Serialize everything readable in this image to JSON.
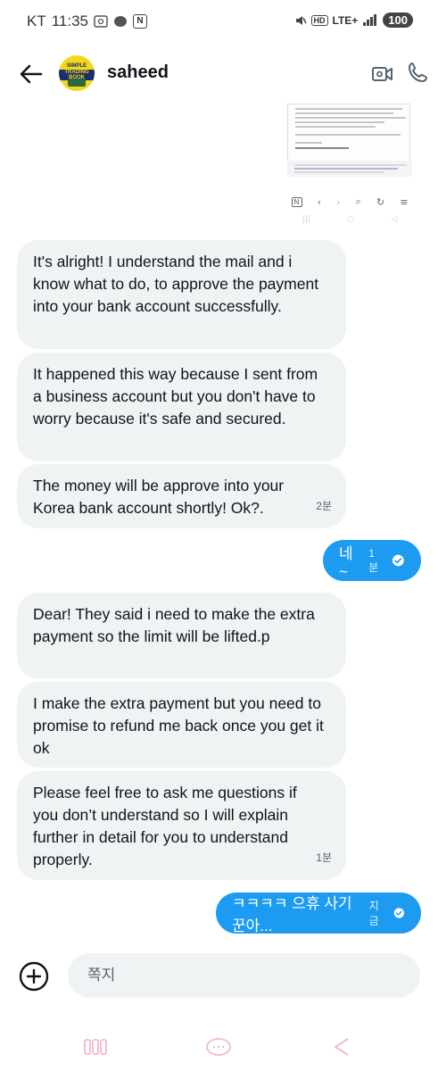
{
  "status_bar": {
    "carrier": "KT",
    "time": "11:35",
    "hd_label": "HD",
    "network": "LTE+",
    "battery": "100"
  },
  "header": {
    "username": "saheed",
    "avatar_text_line1": "SIMPLE",
    "avatar_text_line2": "TRADING BOOK"
  },
  "attachment": {
    "nav_n_label": "N"
  },
  "messages": [
    {
      "direction": "in",
      "text": "It's alright! I understand the mail and i know what to do, to approve the payment into your bank account successfully.",
      "time": ""
    },
    {
      "direction": "in",
      "text": "It happened this way because I sent from a business account but you don't have to worry because it's safe and secured.",
      "time": ""
    },
    {
      "direction": "in",
      "text": "The money will be approve into your Korea bank account shortly! Ok?.",
      "time": "2분"
    },
    {
      "direction": "out",
      "text": "네~",
      "time": "1분"
    },
    {
      "direction": "in",
      "text": "Dear! They said i need to make the extra payment so the limit will be lifted.p",
      "time": ""
    },
    {
      "direction": "in",
      "text": "I  make the extra payment but you need to promise to refund me back once you get it ok",
      "time": ""
    },
    {
      "direction": "in",
      "text": "Please feel free to ask me questions if you don’t understand so I will explain further in detail for you to understand properly.",
      "time": "1분"
    },
    {
      "direction": "out",
      "text": "ㅋㅋㅋㅋ 으휴 사기꾼아...",
      "time": "지금"
    }
  ],
  "composer": {
    "placeholder": "쪽지"
  },
  "colors": {
    "accent": "#1d9bf0",
    "incoming_bubble": "#eff3f4",
    "text": "#0f1419",
    "muted": "#536471"
  }
}
